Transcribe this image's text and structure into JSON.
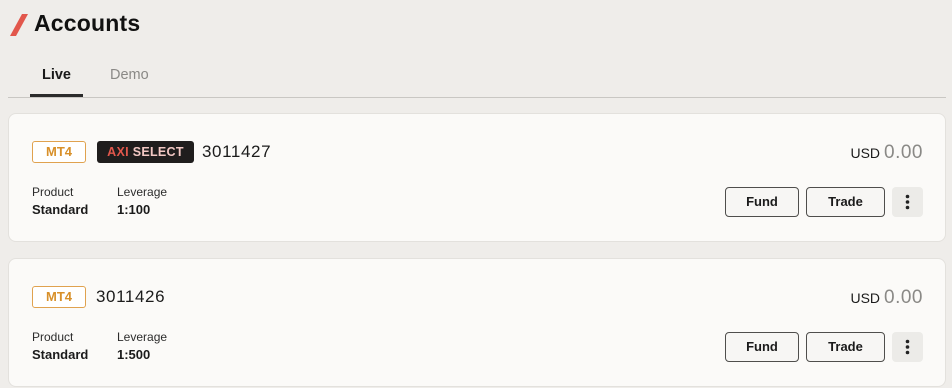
{
  "page": {
    "title": "Accounts"
  },
  "tabs": [
    {
      "label": "Live",
      "active": true
    },
    {
      "label": "Demo",
      "active": false
    }
  ],
  "accounts": [
    {
      "platform": "MT4",
      "tag": {
        "prefix": "AXI",
        "suffix": "SELECT"
      },
      "number": "3011427",
      "currency": "USD",
      "balance": "0.00",
      "product_label": "Product",
      "product": "Standard",
      "leverage_label": "Leverage",
      "leverage": "1:100",
      "fund_label": "Fund",
      "trade_label": "Trade"
    },
    {
      "platform": "MT4",
      "number": "3011426",
      "currency": "USD",
      "balance": "0.00",
      "product_label": "Product",
      "product": "Standard",
      "leverage_label": "Leverage",
      "leverage": "1:500",
      "fund_label": "Fund",
      "trade_label": "Trade"
    }
  ],
  "icons": {
    "logo": "slash-logo",
    "more": "more-vertical-icon"
  },
  "colors": {
    "accent": "#e2574c",
    "platform_badge": "#d8902a",
    "background": "#efedea"
  }
}
